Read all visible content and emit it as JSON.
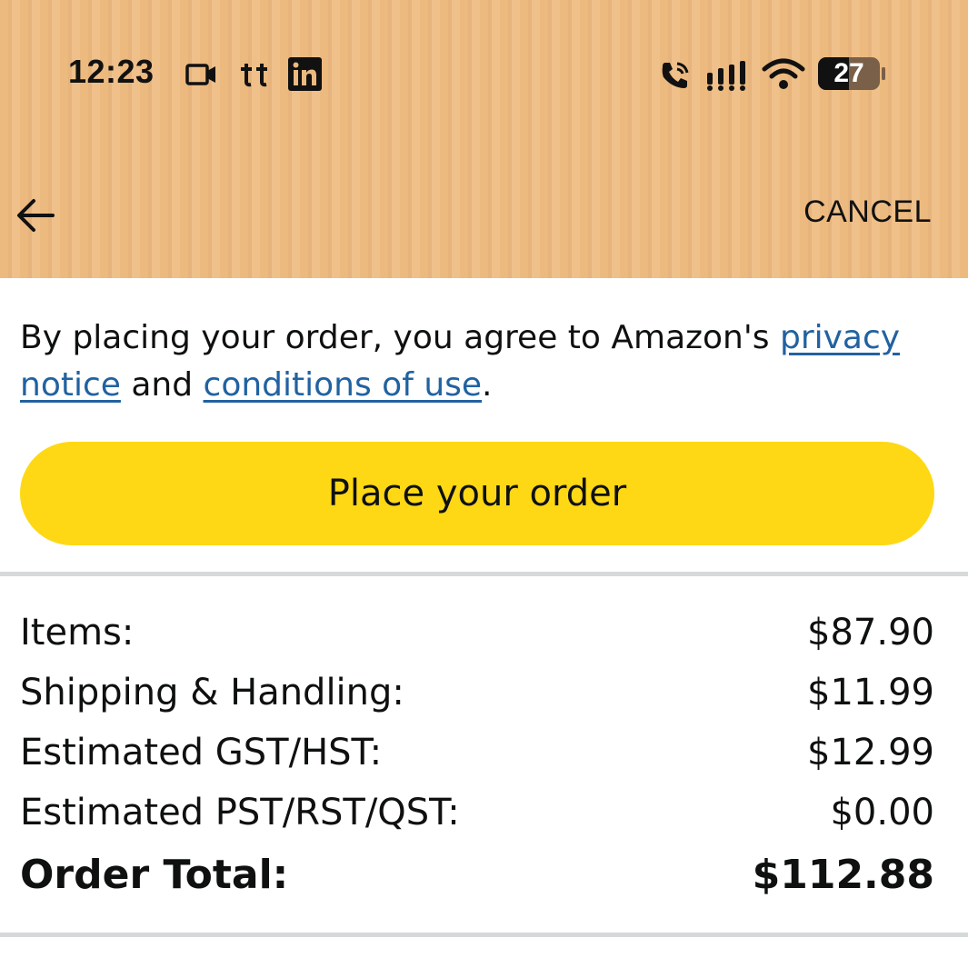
{
  "status_bar": {
    "time": "12:23",
    "left_icons": [
      "video-camera-icon",
      "tiktok-icon",
      "linkedin-icon"
    ],
    "right_icons": [
      "wifi-call-icon",
      "signal-icon",
      "wifi-icon"
    ],
    "battery": "27"
  },
  "header": {
    "back_icon": "arrow-left-icon",
    "cancel_label": "CANCEL"
  },
  "agreement": {
    "prefix": "By placing your order, you agree to Amazon's ",
    "privacy_link": "privacy notice",
    "middle": " and ",
    "conditions_link": "conditions of use",
    "suffix": "."
  },
  "place_order_label": "Place your order",
  "summary": {
    "rows": [
      {
        "label": "Items:",
        "value": "$87.90"
      },
      {
        "label": "Shipping & Handling:",
        "value": "$11.99"
      },
      {
        "label": "Estimated GST/HST:",
        "value": "$12.99"
      },
      {
        "label": "Estimated PST/RST/QST:",
        "value": "$0.00"
      }
    ],
    "total_label": "Order Total:",
    "total_value": "$112.88"
  },
  "colors": {
    "header_bg": "#ecb97f",
    "button_yellow": "#fed814",
    "link_blue": "#2162a1",
    "divider": "#d5d9d9"
  }
}
